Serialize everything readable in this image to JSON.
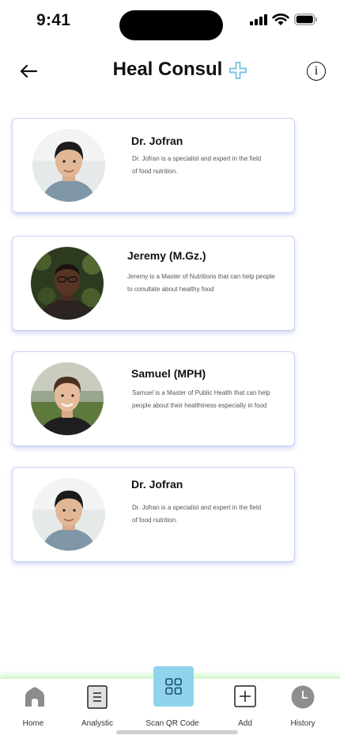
{
  "status_bar": {
    "time": "9:41"
  },
  "header": {
    "title": "Heal Consul"
  },
  "consultants": [
    {
      "name": "Dr. Jofran",
      "description": "Dr. Jofran is a specialist and expert in the field of food nutrition."
    },
    {
      "name": "Jeremy (M.Gz.)",
      "description": "Jeremy is a Master of Nutritions that can help people  to conultate about healthy food"
    },
    {
      "name": "Samuel (MPH)",
      "description": "Samuel is a Master of Public Health that can help people about their healthiness especially in food"
    },
    {
      "name": "Dr. Jofran",
      "description": "Dr. Jofran is a specialist and expert in the field of food nutrition."
    }
  ],
  "nav": {
    "home": "Home",
    "analytic": "Analystic",
    "scan": "Scan QR Code",
    "add": "Add",
    "history": "History"
  },
  "colors": {
    "accent": "#8fd4ec",
    "card_border": "#c9d3f7",
    "nav_glow": "#d7f7d0"
  }
}
